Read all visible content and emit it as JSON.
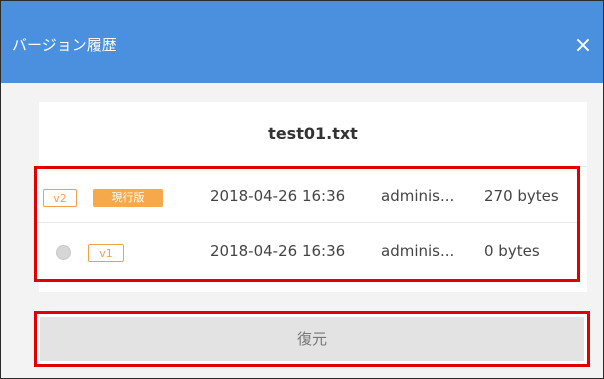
{
  "dialog": {
    "title": "バージョン履歴",
    "close_symbol": "×"
  },
  "file": {
    "name": "test01.txt"
  },
  "versions": [
    {
      "version": "v2",
      "badge": "現行版",
      "date": "2018-04-26 16:36",
      "user": "adminis...",
      "size": "270 bytes",
      "selectable": false
    },
    {
      "version": "v1",
      "badge": "",
      "date": "2018-04-26 16:36",
      "user": "adminis...",
      "size": "0 bytes",
      "selectable": true,
      "selected": false
    }
  ],
  "actions": {
    "restore_label": "復元"
  },
  "colors": {
    "header": "#4a90de",
    "tag_orange": "#f0a04b",
    "highlight_red": "#e00000"
  }
}
